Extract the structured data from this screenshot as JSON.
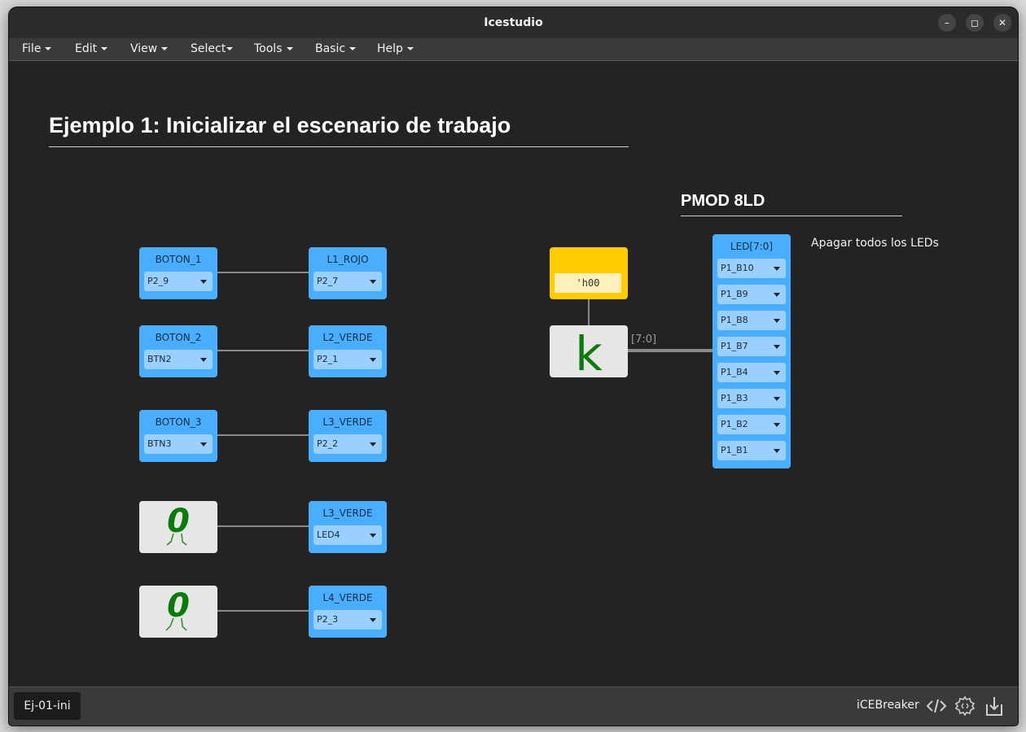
{
  "window": {
    "title": "Icestudio"
  },
  "menubar": [
    {
      "label": "File"
    },
    {
      "label": "Edit"
    },
    {
      "label": "View"
    },
    {
      "label": "Select"
    },
    {
      "label": "Tools"
    },
    {
      "label": "Basic"
    },
    {
      "label": "Help"
    }
  ],
  "canvas": {
    "main_heading": "Ejemplo 1: Inicializar el escenario de trabajo",
    "pmod_heading": "PMOD 8LD",
    "note": "Apagar todos los LEDs",
    "inputs": [
      {
        "label": "BOTON_1",
        "pin": "P2_9"
      },
      {
        "label": "BOTON_2",
        "pin": "BTN2"
      },
      {
        "label": "BOTON_3",
        "pin": "BTN3"
      }
    ],
    "outputs": [
      {
        "label": "L1_ROJO",
        "pin": "P2_7"
      },
      {
        "label": "L2_VERDE",
        "pin": "P2_1"
      },
      {
        "label": "L3_VERDE",
        "pin": "P2_2"
      },
      {
        "label": "L3_VERDE",
        "pin": "LED4"
      },
      {
        "label": "L4_VERDE",
        "pin": "P2_3"
      }
    ],
    "constant": {
      "value": "'h00"
    },
    "bus_label": "[7:0]",
    "led_bus": {
      "label": "LED[7:0]",
      "pins": [
        "P1_B10",
        "P1_B9",
        "P1_B8",
        "P1_B7",
        "P1_B4",
        "P1_B3",
        "P1_B2",
        "P1_B1"
      ]
    }
  },
  "statusbar": {
    "tab": "Ej-01-ini",
    "board": "iCEBreaker"
  },
  "colors": {
    "pin_block": "#49aeff",
    "constant_block": "#ffcc00",
    "background": "#232323",
    "k_glyph": "#0a7a0a"
  }
}
